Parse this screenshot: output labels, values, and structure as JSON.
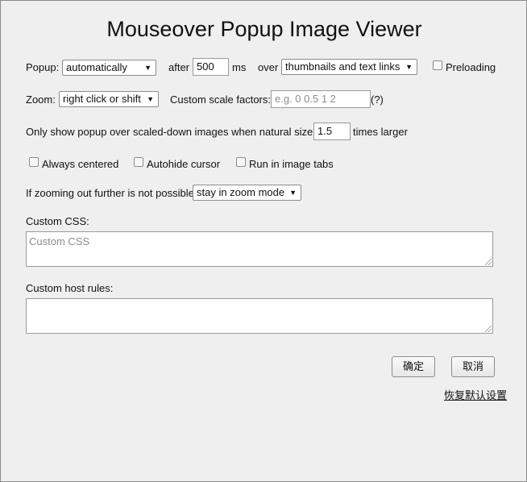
{
  "title": "Mouseover Popup Image Viewer",
  "popup": {
    "label": "Popup:",
    "mode": "automatically",
    "after_label": "after",
    "delay": "500",
    "ms_label": "ms",
    "over_label": "over",
    "target": "thumbnails and text links",
    "preloading_label": "Preloading"
  },
  "zoom": {
    "label": "Zoom:",
    "trigger": "right click or shift",
    "scale_label": "Custom scale factors:",
    "scale_placeholder": "e.g. 0 0.5 1 2",
    "help": "(?)"
  },
  "scaled": {
    "before": "Only show popup over scaled-down images when natural size is",
    "value": "1.5",
    "after": "times larger"
  },
  "options": {
    "always_centered": "Always centered",
    "autohide_cursor": "Autohide cursor",
    "run_in_image_tabs": "Run in image tabs"
  },
  "zoom_out": {
    "label": "If zooming out further is not possible,",
    "value": "stay in zoom mode"
  },
  "custom_css": {
    "label": "Custom CSS:",
    "placeholder": "Custom CSS"
  },
  "host_rules": {
    "label": "Custom host rules:"
  },
  "buttons": {
    "ok": "确定",
    "cancel": "取消",
    "reset": "恢复默认设置"
  },
  "icons": {
    "dropdown": "triangle-down-icon",
    "resize": "resize-grip-icon"
  }
}
